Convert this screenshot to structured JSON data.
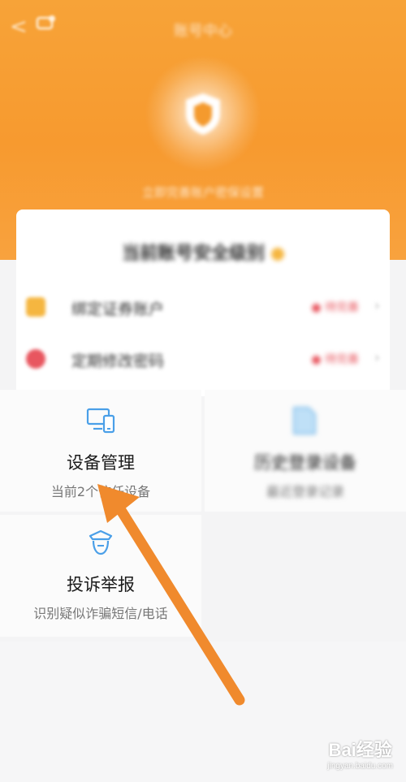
{
  "header": {
    "title": "账号中心",
    "subtitle": "立即完善账户密保设置",
    "back_glyph": "<"
  },
  "security_card": {
    "level_title": "当前账号安全级别",
    "items": [
      {
        "label": "绑定证券账户",
        "status": "待完善",
        "icon": "id-card-icon",
        "color": "#f5b640"
      },
      {
        "label": "定期修改密码",
        "status": "待完善",
        "icon": "lock-icon",
        "color": "#e8565f"
      }
    ]
  },
  "tiles": [
    {
      "title": "设备管理",
      "subtitle": "当前2个信任设备",
      "icon": "devices-icon"
    },
    {
      "title": "历史登录设备",
      "subtitle": "最近登录记录",
      "icon": "document-icon"
    },
    {
      "title": "投诉举报",
      "subtitle": "识别疑似诈骗短信/电话",
      "icon": "guard-icon"
    }
  ],
  "watermark": {
    "logo": "Bai经验",
    "url": "jingyan.baidu.com"
  },
  "colors": {
    "accent": "#f79a2f",
    "icon_blue": "#4a9fe8",
    "arrow": "#f08a2d"
  }
}
